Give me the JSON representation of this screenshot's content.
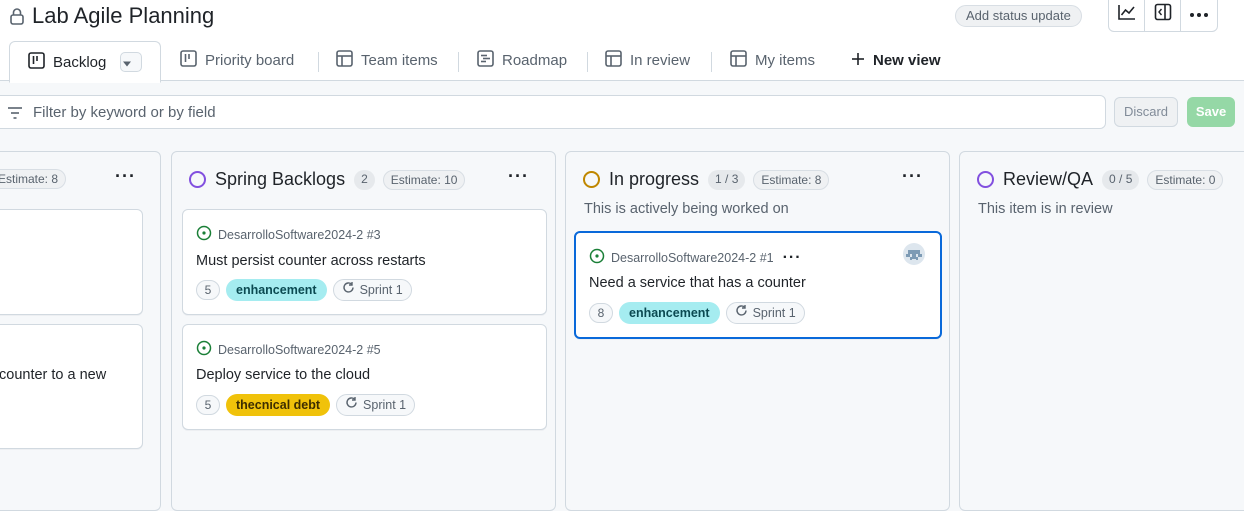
{
  "header": {
    "title": "Lab Agile Planning",
    "status_button": "Add status update",
    "icons": [
      "lock-icon",
      "graph-icon",
      "sidebar-icon",
      "kebab-icon"
    ]
  },
  "tabs": [
    {
      "label": "Backlog",
      "icon": "board-icon",
      "active": true
    },
    {
      "label": "Priority board",
      "icon": "board-icon"
    },
    {
      "label": "Team items",
      "icon": "table-icon"
    },
    {
      "label": "Roadmap",
      "icon": "roadmap-icon"
    },
    {
      "label": "In review",
      "icon": "table-icon"
    },
    {
      "label": "My items",
      "icon": "table-icon"
    }
  ],
  "new_view_label": "New view",
  "filter": {
    "placeholder": "Filter by keyword or by field"
  },
  "actions": {
    "discard": "Discard",
    "save": "Save"
  },
  "colors": {
    "accent": "#0969da",
    "enhancement": "#a5ecf0",
    "tech_debt": "#f0c20a",
    "save": "#95d8a6"
  },
  "columns": {
    "partial": {
      "estimate": "Estimate: 8",
      "cards": [
        {
          "title": ""
        },
        {
          "title": "counter to a new"
        }
      ]
    },
    "spring": {
      "name": "Spring Backlogs",
      "count": "2",
      "estimate": "Estimate: 10",
      "circle_color": "#8250df",
      "cards": [
        {
          "repo": "DesarrolloSoftware2024-2 #3",
          "title": "Must persist counter across restarts",
          "estimate": "5",
          "label": "enhancement",
          "sprint": "Sprint 1"
        },
        {
          "repo": "DesarrolloSoftware2024-2 #5",
          "title": "Deploy service to the cloud",
          "estimate": "5",
          "label": "thecnical debt",
          "sprint": "Sprint 1"
        }
      ]
    },
    "progress": {
      "name": "In progress",
      "count": "1 / 3",
      "estimate": "Estimate: 8",
      "description": "This is actively being worked on",
      "circle_color": "#bf8700",
      "cards": [
        {
          "repo": "DesarrolloSoftware2024-2 #1",
          "title": "Need a service that has a counter",
          "estimate": "8",
          "label": "enhancement",
          "sprint": "Sprint 1"
        }
      ]
    },
    "review": {
      "name": "Review/QA",
      "count": "0 / 5",
      "estimate": "Estimate: 0",
      "description": "This item is in review",
      "circle_color": "#8250df"
    }
  }
}
